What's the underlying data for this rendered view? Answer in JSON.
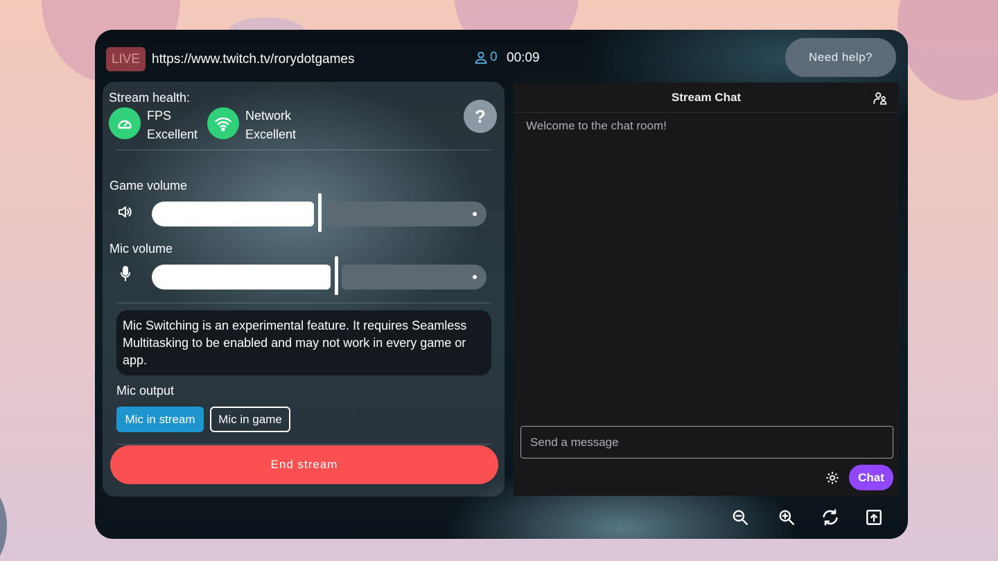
{
  "header": {
    "live_label": "LIVE",
    "url": "https://www.twitch.tv/rorydotgames",
    "viewer_count": "0",
    "timer": "00:09",
    "help_label": "Need help?"
  },
  "health": {
    "label": "Stream health:",
    "fps_label": "FPS",
    "fps_status": "Excellent",
    "network_label": "Network",
    "network_status": "Excellent",
    "help_glyph": "?",
    "icons": {
      "fps": "speedometer-icon",
      "network": "wifi-icon"
    },
    "status_color": "#30d17a"
  },
  "game_volume": {
    "label": "Game volume",
    "level": 0.5,
    "icon": "speaker-icon"
  },
  "mic_volume": {
    "label": "Mic volume",
    "level": 0.55,
    "icon": "microphone-icon"
  },
  "notice": "Mic Switching is an experimental feature. It requires Seamless Multitasking to be enabled and may not work in every game or app.",
  "mic_output": {
    "label": "Mic output",
    "options": [
      "Mic in stream",
      "Mic in game"
    ],
    "selected": "Mic in stream",
    "selected_color": "#1f95cf"
  },
  "end_stream_label": "End stream",
  "end_stream_color": "#fa5051",
  "chat": {
    "title": "Stream Chat",
    "welcome": "Welcome to the chat room!",
    "input_placeholder": "Send a message",
    "send_label": "Chat",
    "send_color": "#9147ff"
  },
  "toolbar": {
    "icons": [
      "zoom-out-icon",
      "zoom-in-icon",
      "rotate-icon",
      "share-screen-icon"
    ]
  }
}
